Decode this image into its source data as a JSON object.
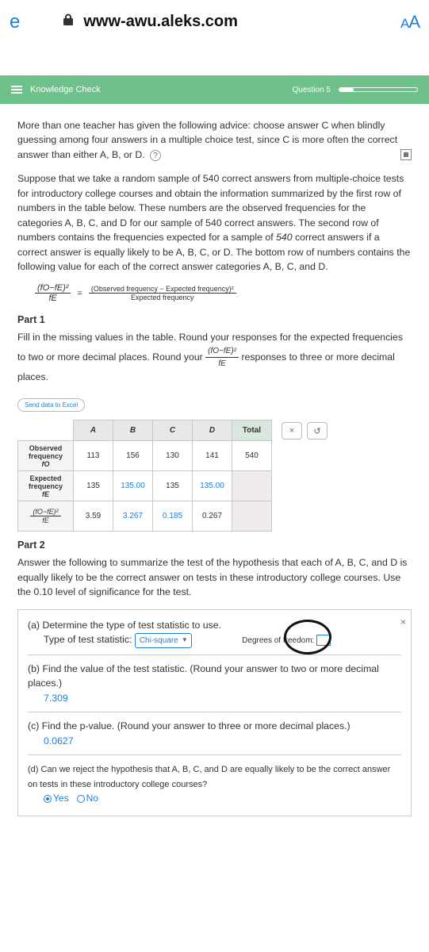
{
  "browser": {
    "left_letter": "e",
    "url": "www-awu.aleks.com",
    "text_size": "AA"
  },
  "header": {
    "title": "Knowledge Check",
    "question": "Question 5"
  },
  "problem": {
    "p1": "More than one teacher has given the following advice: choose answer C when blindly guessing among four answers in a multiple choice test, since C is more often the correct answer than either A, B, or D.",
    "p2_a": "Suppose that we take a random sample of ",
    "p2_b": "540",
    "p2_c": " correct answers from multiple-choice tests for introductory college courses and obtain the information summarized by the first row of numbers in the table below. These numbers are the observed frequencies for the categories A, B, C, and D for our sample of ",
    "p2_d": "540",
    "p2_e": " correct answers. The second row of numbers contains the frequencies expected for a sample of ",
    "p2_f": "540",
    "p2_g": " correct answers if a correct answer is equally likely to be A, B, C, or D. The bottom row of numbers contains the following value for each of the correct answer categories A, B, C, and D.",
    "formula_num": "(fO−fE)²",
    "formula_den": "fE",
    "formula_rhs_num": "(Observed frequency − Expected frequency)²",
    "formula_rhs_den": "Expected frequency",
    "eq": "="
  },
  "part1": {
    "heading": "Part 1",
    "instr_a": "Fill in the missing values in the table. Round your responses for the expected frequencies to two or more decimal places. Round your ",
    "instr_b": " responses to three or more decimal places.",
    "btn_excel": "Send data to Excel",
    "table": {
      "cols": [
        "A",
        "B",
        "C",
        "D"
      ],
      "total": "Total",
      "rows": [
        {
          "label": "Observed frequency",
          "sub": "fO",
          "cells": [
            "113",
            "156",
            "130",
            "141"
          ],
          "total": "540"
        },
        {
          "label": "Expected frequency",
          "sub": "fE",
          "cells": [
            "135",
            "135.00",
            "135",
            "135.00"
          ],
          "total": ""
        },
        {
          "label": "(fO−fE)²",
          "sub": "fE",
          "cells": [
            "3.59",
            "3.267",
            "0.185",
            "0.267"
          ],
          "total": ""
        }
      ]
    },
    "x_btn": "×",
    "reset_btn": "↺"
  },
  "part2": {
    "heading": "Part 2",
    "instr": "Answer the following to summarize the test of the hypothesis that each of A, B, C, and D is equally likely to be the correct answer on tests in these introductory college courses. Use the ",
    "alpha": "0.10",
    "instr2": " level of significance for the test.",
    "a": {
      "q": "(a)  Determine the type of test statistic to use.",
      "label": "Type of test statistic:",
      "value": "Chi-square",
      "deg_label": "Degrees of freedom:"
    },
    "b": {
      "q": "(b)  Find the value of the test statistic. (Round your answer to two or more decimal places.)",
      "ans": "7.309"
    },
    "c": {
      "q": "(c)  Find the p-value. (Round your answer to three or more decimal places.)",
      "ans": "0.0627"
    },
    "d": {
      "q": "(d) Can we reject the hypothesis that A, B, C, and D are equally likely to be the correct answer on tests in these introductory college courses?",
      "yes": "Yes",
      "no": "No"
    },
    "close": "×"
  }
}
